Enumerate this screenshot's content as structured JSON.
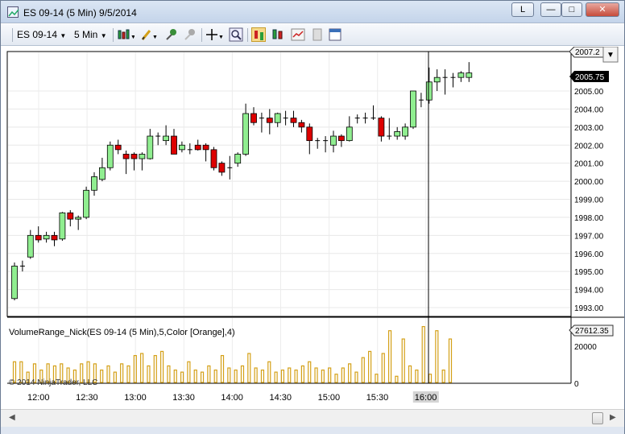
{
  "window": {
    "title": "ES 09-14 (5 Min)  9/5/2014",
    "link_button": "L",
    "minimize": "—",
    "maximize": "□",
    "close": "✕"
  },
  "toolbar": {
    "instrument": "ES 09-14",
    "interval": "5 Min",
    "icons": [
      "bar-type-icon",
      "drawing-tool-icon",
      "pin-icon",
      "disabled-pin-icon",
      "crosshair-icon",
      "zoom-icon",
      "chart-style-icon",
      "indicators-icon",
      "strategies-icon",
      "properties-icon",
      "data-box-icon"
    ]
  },
  "chart": {
    "price_axis_labels": [
      "2005.00",
      "2004.00",
      "2003.00",
      "2002.00",
      "2001.00",
      "2000.00",
      "1999.00",
      "1998.00",
      "1997.00",
      "1996.00",
      "1995.00",
      "1994.00",
      "1993.00"
    ],
    "price_marker_top": "2007.2",
    "last_price": "2005.75",
    "time_labels": [
      "12:00",
      "12:30",
      "13:00",
      "13:30",
      "14:00",
      "14:30",
      "15:00",
      "15:30",
      "16:00"
    ],
    "highlighted_time": "16:00",
    "indicator_label": "VolumeRange_Nick(ES 09-14 (5 Min),5,Color [Orange],4)",
    "volume_axis_labels": [
      "20000",
      "0"
    ],
    "volume_marker": "27612.35",
    "copyright": "© 2014 NinjaTrader, LLC",
    "colors": {
      "up": "#90ee90",
      "down": "#dd0000",
      "volume": "#d4a017",
      "crosshair": "#000000"
    }
  },
  "chart_data": {
    "type": "candlestick",
    "instrument": "ES 09-14",
    "interval": "5 Min",
    "ylim": [
      1992.6,
      2007.2
    ],
    "candles": [
      {
        "o": 1993.5,
        "h": 1995.5,
        "l": 1993.4,
        "c": 1995.3
      },
      {
        "o": 1995.3,
        "h": 1995.6,
        "l": 1995.0,
        "c": 1995.3
      },
      {
        "o": 1995.8,
        "h": 1997.3,
        "l": 1995.7,
        "c": 1997.0
      },
      {
        "o": 1997.0,
        "h": 1997.5,
        "l": 1996.6,
        "c": 1996.75
      },
      {
        "o": 1996.8,
        "h": 1997.2,
        "l": 1996.6,
        "c": 1997.0
      },
      {
        "o": 1997.0,
        "h": 1997.2,
        "l": 1996.4,
        "c": 1996.75
      },
      {
        "o": 1996.8,
        "h": 1998.3,
        "l": 1996.7,
        "c": 1998.25
      },
      {
        "o": 1998.25,
        "h": 1998.4,
        "l": 1997.5,
        "c": 1997.9
      },
      {
        "o": 1997.9,
        "h": 1998.1,
        "l": 1997.3,
        "c": 1998.0
      },
      {
        "o": 1998.0,
        "h": 1999.7,
        "l": 1997.9,
        "c": 1999.5
      },
      {
        "o": 1999.5,
        "h": 2000.5,
        "l": 1999.2,
        "c": 2000.25
      },
      {
        "o": 2000.1,
        "h": 2001.3,
        "l": 2000.0,
        "c": 2000.75
      },
      {
        "o": 2000.75,
        "h": 2002.2,
        "l": 2000.6,
        "c": 2002.0
      },
      {
        "o": 2002.0,
        "h": 2002.3,
        "l": 2001.5,
        "c": 2001.75
      },
      {
        "o": 2001.5,
        "h": 2001.7,
        "l": 2000.4,
        "c": 2001.25
      },
      {
        "o": 2001.5,
        "h": 2001.6,
        "l": 2000.6,
        "c": 2001.25
      },
      {
        "o": 2001.25,
        "h": 2001.6,
        "l": 2000.6,
        "c": 2001.5
      },
      {
        "o": 2001.25,
        "h": 2002.9,
        "l": 2001.2,
        "c": 2002.5
      },
      {
        "o": 2002.5,
        "h": 2002.7,
        "l": 2002.0,
        "c": 2002.5
      },
      {
        "o": 2002.25,
        "h": 2003.1,
        "l": 2002.0,
        "c": 2002.5
      },
      {
        "o": 2002.5,
        "h": 2002.9,
        "l": 2001.5,
        "c": 2001.5
      },
      {
        "o": 2001.75,
        "h": 2002.2,
        "l": 2001.6,
        "c": 2002.0
      },
      {
        "o": 2001.75,
        "h": 2002.1,
        "l": 2001.5,
        "c": 2001.75
      },
      {
        "o": 2002.0,
        "h": 2002.3,
        "l": 2001.7,
        "c": 2001.75
      },
      {
        "o": 2002.0,
        "h": 2002.1,
        "l": 2001.1,
        "c": 2001.75
      },
      {
        "o": 2001.75,
        "h": 2001.9,
        "l": 2000.6,
        "c": 2000.75
      },
      {
        "o": 2001.0,
        "h": 2001.1,
        "l": 2000.3,
        "c": 2000.5
      },
      {
        "o": 2000.75,
        "h": 2001.4,
        "l": 2000.1,
        "c": 2000.75
      },
      {
        "o": 2001.0,
        "h": 2001.6,
        "l": 2000.8,
        "c": 2001.5
      },
      {
        "o": 2001.5,
        "h": 2004.3,
        "l": 2001.4,
        "c": 2003.75
      },
      {
        "o": 2003.75,
        "h": 2004.1,
        "l": 2003.1,
        "c": 2003.25
      },
      {
        "o": 2003.5,
        "h": 2003.8,
        "l": 2002.7,
        "c": 2003.5
      },
      {
        "o": 2003.5,
        "h": 2004.0,
        "l": 2002.6,
        "c": 2003.25
      },
      {
        "o": 2003.25,
        "h": 2003.8,
        "l": 2003.0,
        "c": 2003.75
      },
      {
        "o": 2003.5,
        "h": 2003.9,
        "l": 2003.1,
        "c": 2003.5
      },
      {
        "o": 2003.5,
        "h": 2003.9,
        "l": 2003.0,
        "c": 2003.25
      },
      {
        "o": 2003.25,
        "h": 2003.4,
        "l": 2002.7,
        "c": 2003.0
      },
      {
        "o": 2003.0,
        "h": 2003.2,
        "l": 2001.5,
        "c": 2002.25
      },
      {
        "o": 2002.25,
        "h": 2002.4,
        "l": 2001.8,
        "c": 2002.25
      },
      {
        "o": 2002.25,
        "h": 2002.5,
        "l": 2001.6,
        "c": 2002.25
      },
      {
        "o": 2002.0,
        "h": 2002.8,
        "l": 2001.6,
        "c": 2002.5
      },
      {
        "o": 2002.5,
        "h": 2002.6,
        "l": 2001.9,
        "c": 2002.25
      },
      {
        "o": 2002.25,
        "h": 2003.6,
        "l": 2002.2,
        "c": 2003.0
      },
      {
        "o": 2003.5,
        "h": 2003.7,
        "l": 2003.2,
        "c": 2003.5
      },
      {
        "o": 2003.5,
        "h": 2003.8,
        "l": 2003.2,
        "c": 2003.5
      },
      {
        "o": 2003.5,
        "h": 2004.2,
        "l": 2003.4,
        "c": 2003.5
      },
      {
        "o": 2003.5,
        "h": 2003.6,
        "l": 2002.2,
        "c": 2002.5
      },
      {
        "o": 2002.5,
        "h": 2003.5,
        "l": 2002.3,
        "c": 2002.5
      },
      {
        "o": 2002.5,
        "h": 2003.0,
        "l": 2002.3,
        "c": 2002.75
      },
      {
        "o": 2002.5,
        "h": 2003.2,
        "l": 2002.3,
        "c": 2003.0
      },
      {
        "o": 2003.0,
        "h": 2005.0,
        "l": 2002.9,
        "c": 2005.0
      },
      {
        "o": 2004.5,
        "h": 2004.9,
        "l": 2004.1,
        "c": 2004.5
      },
      {
        "o": 2004.5,
        "h": 2006.3,
        "l": 2004.3,
        "c": 2005.5
      },
      {
        "o": 2005.5,
        "h": 2006.2,
        "l": 2005.0,
        "c": 2005.75
      },
      {
        "o": 2005.75,
        "h": 2006.2,
        "l": 2004.8,
        "c": 2005.75
      },
      {
        "o": 2005.75,
        "h": 2006.0,
        "l": 2005.2,
        "c": 2005.75
      },
      {
        "o": 2005.75,
        "h": 2006.1,
        "l": 2005.5,
        "c": 2006.0
      },
      {
        "o": 2005.75,
        "h": 2006.6,
        "l": 2005.5,
        "c": 2006.0
      }
    ],
    "volume": [
      10000,
      10000,
      5000,
      9000,
      6000,
      9000,
      8000,
      9000,
      7000,
      6000,
      9000,
      10000,
      9000,
      6000,
      8000,
      5000,
      9000,
      8000,
      13000,
      14000,
      8000,
      13000,
      15000,
      8000,
      6000,
      5000,
      10000,
      6000,
      5000,
      8000,
      6000,
      13000,
      7000,
      6000,
      8000,
      14000,
      7000,
      6000,
      10000,
      5000,
      6000,
      7000,
      6000,
      8000,
      10000,
      7000,
      6000,
      7000,
      4000,
      7000,
      9000,
      5000,
      12000,
      15000,
      4000,
      14000,
      25000,
      3000,
      21000,
      8000,
      6000,
      27000,
      4000,
      25000,
      6000,
      21000
    ],
    "vlim": [
      0,
      28000
    ],
    "time_ticks": [
      "12:00",
      "12:30",
      "13:00",
      "13:30",
      "14:00",
      "14:30",
      "15:00",
      "15:30",
      "16:00"
    ]
  }
}
